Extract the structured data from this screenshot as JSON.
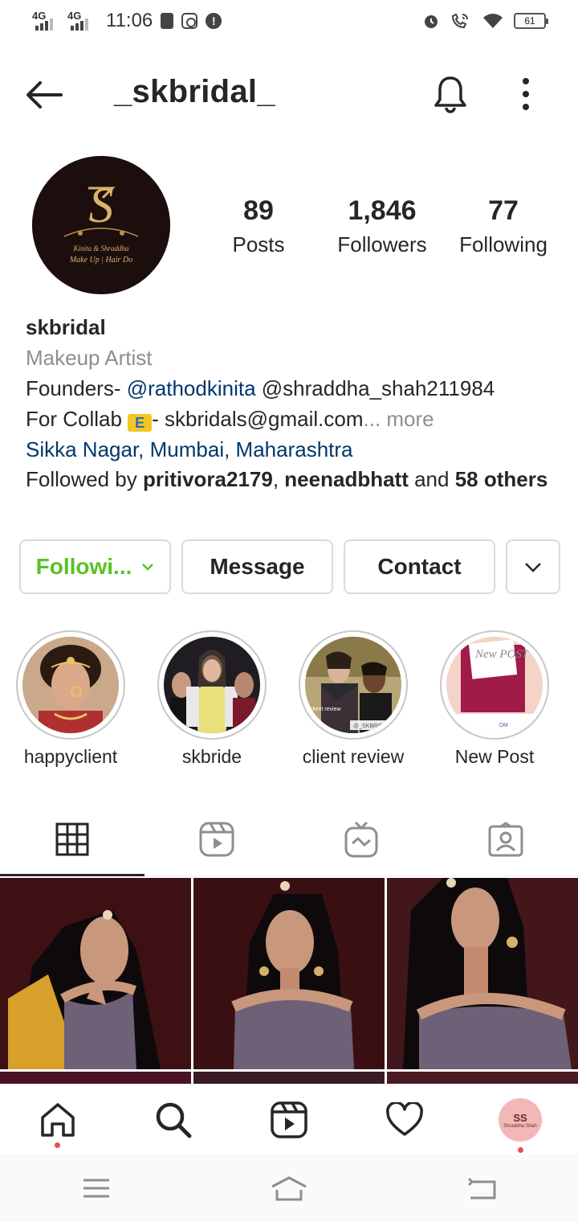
{
  "status_bar": {
    "network1": "4G",
    "network2": "4G",
    "time": "11:06",
    "battery": "61"
  },
  "header": {
    "username": "_skbridal_"
  },
  "profile": {
    "avatar_text_top": "Kinita & Shraddha",
    "avatar_text_bottom": "Make Up | Hair Do",
    "avatar_monogram": "S",
    "stats": [
      {
        "value": "89",
        "label": "Posts"
      },
      {
        "value": "1,846",
        "label": "Followers"
      },
      {
        "value": "77",
        "label": "Following"
      }
    ]
  },
  "bio": {
    "name": "skbridal",
    "category": "Makeup Artist",
    "founders_prefix": "Founders- ",
    "mention1": "@rathodkinita",
    "mention2": " @shraddha_shah211984",
    "collab_prefix": "For Collab ",
    "emoji": "E",
    "collab_text": "- skbridals@gmail.com",
    "ellipsis": "...",
    "more": " more",
    "location": "Sikka Nagar, Mumbai, Maharashtra",
    "followed_prefix": "Followed by ",
    "follower1": "pritivora2179",
    "comma": ", ",
    "follower2": "neenadbhatt",
    "and": " and ",
    "others": "58 others"
  },
  "buttons": {
    "following": "Followi...",
    "message": "Message",
    "contact": "Contact"
  },
  "highlights": [
    {
      "label": "happyclient"
    },
    {
      "label": "skbride"
    },
    {
      "label": "client review",
      "overlay": "client review",
      "tag": "@_SKBRIDA"
    },
    {
      "label": "New Post",
      "overlay": "New POST",
      "tag": "DM"
    }
  ],
  "tabs": [
    "grid-icon",
    "reels-icon",
    "igtv-icon",
    "tagged-icon"
  ],
  "bottom_nav": [
    "home-icon",
    "search-icon",
    "reels-icon",
    "heart-icon",
    "profile-avatar"
  ],
  "bottom_avatar_text": "Shraddha Shah",
  "colors": {
    "following_green": "#58c322",
    "link_blue": "#00376b",
    "muted_gray": "#8e8e8e",
    "notification_red": "#ed4956"
  }
}
